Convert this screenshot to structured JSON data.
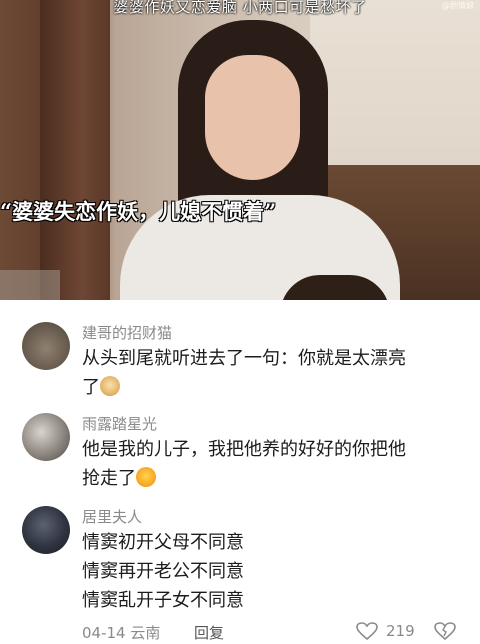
{
  "video": {
    "title": "婆婆作妖又恋爱脑 小两口可是愁坏了",
    "watermark": "@剧情娘",
    "subtitle": "“婆婆失恋作妖，儿媳不惯着”"
  },
  "comments": [
    {
      "username": "建哥的招财猫",
      "text_lines": [
        "从头到尾就听进去了一句：你就是太漂亮",
        "了"
      ],
      "emoji": "doge-emoji"
    },
    {
      "username": "雨露踏星光",
      "text_lines": [
        "他是我的儿子，我把他养的好好的你把他",
        "抢走了"
      ],
      "emoji": "sob-emoji"
    },
    {
      "username": "居里夫人",
      "text_lines": [
        "情窦初开父母不同意",
        "情窦再开老公不同意",
        "情窦乱开子女不同意"
      ],
      "emoji": null
    }
  ],
  "footer": {
    "date": "04-14 云南",
    "reply_label": "回复",
    "like_icon": "heart-outline-icon",
    "like_count": "219",
    "dislike_icon": "broken-heart-icon"
  }
}
